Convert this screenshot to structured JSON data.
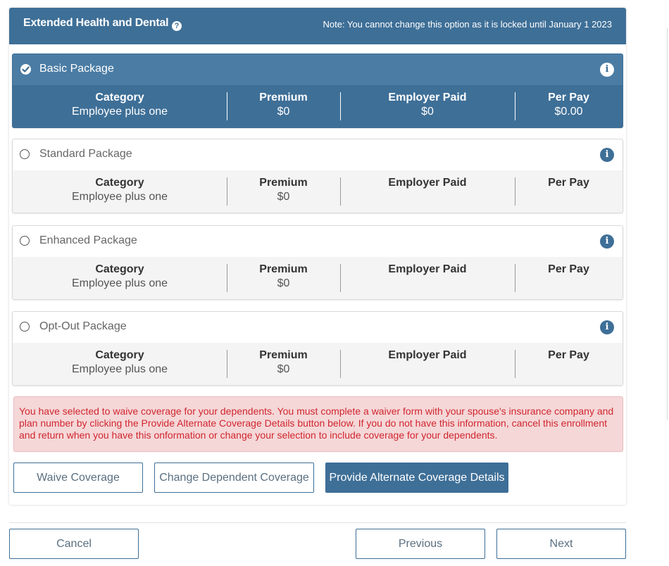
{
  "section": {
    "title": "Extended Health and Dental",
    "help_icon": "?",
    "note": "Note: You cannot change this option as it is locked until January 1 2023"
  },
  "columns": {
    "category": "Category",
    "premium": "Premium",
    "employer_paid": "Employer Paid",
    "per_pay": "Per Pay"
  },
  "packages": [
    {
      "name": "Basic Package",
      "selected": true,
      "category": "Employee plus one",
      "premium": "$0",
      "employer_paid": "$0",
      "per_pay": "$0.00"
    },
    {
      "name": "Standard Package",
      "selected": false,
      "category": "Employee plus one",
      "premium": "$0",
      "employer_paid": "",
      "per_pay": ""
    },
    {
      "name": "Enhanced Package",
      "selected": false,
      "category": "Employee plus one",
      "premium": "$0",
      "employer_paid": "",
      "per_pay": ""
    },
    {
      "name": "Opt-Out Package",
      "selected": false,
      "category": "Employee plus one",
      "premium": "$0",
      "employer_paid": "",
      "per_pay": ""
    }
  ],
  "info_icon": "i",
  "alert": {
    "message": "You have selected to waive coverage for your dependents. You must complete a waiver form with your spouse's insurance company and plan number by clicking the Provide Alternate Coverage Details button below.  If you do not have this information, cancel this enrollment and return when you have this onformation or change your selection to include coverage for your dependents."
  },
  "actions": {
    "waive": "Waive Coverage",
    "change": "Change Dependent Coverage",
    "provide": "Provide Alternate Coverage Details"
  },
  "nav": {
    "cancel": "Cancel",
    "previous": "Previous",
    "next": "Next"
  },
  "colors": {
    "header": "#3e6f97",
    "selected_top": "#4a7ca4",
    "alert_bg": "#f5d7d8",
    "alert_text": "#d0262e"
  }
}
